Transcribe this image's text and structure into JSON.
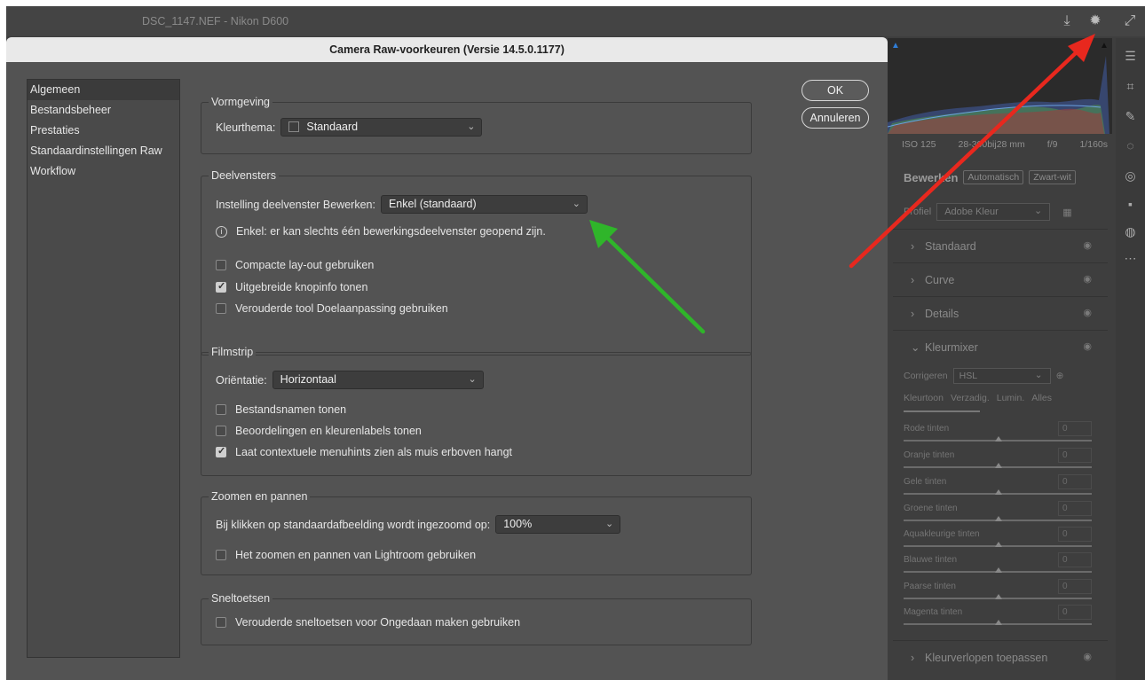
{
  "app": {
    "title": "DSC_1147.NEF  -  Nikon D600",
    "save_icon": "save-icon",
    "settings_icon": "gear-icon",
    "expand_icon": "expand-icon"
  },
  "exif": {
    "iso": "ISO 125",
    "lens": "28-300bij28 mm",
    "aperture": "f/9",
    "shutter": "1/160s"
  },
  "edit_panel": {
    "title": "Bewerken",
    "auto_label": "Automatisch",
    "bw_label": "Zwart-wit",
    "profile_label": "Profiel",
    "profile_value": "Adobe Kleur",
    "sections": [
      {
        "label": "Standaard"
      },
      {
        "label": "Curve"
      },
      {
        "label": "Details"
      },
      {
        "label": "Kleurmixer"
      },
      {
        "label": "Kleurverlopen toepassen"
      }
    ],
    "mixer": {
      "correct_label": "Corrigeren",
      "correct_value": "HSL",
      "tabs": [
        "Kleurtoon",
        "Verzadig.",
        "Lumin.",
        "Alles"
      ],
      "sliders": [
        {
          "label": "Rode tinten",
          "value": "0"
        },
        {
          "label": "Oranje tinten",
          "value": "0"
        },
        {
          "label": "Gele tinten",
          "value": "0"
        },
        {
          "label": "Groene tinten",
          "value": "0"
        },
        {
          "label": "Aquakleurige tinten",
          "value": "0"
        },
        {
          "label": "Blauwe tinten",
          "value": "0"
        },
        {
          "label": "Paarse tinten",
          "value": "0"
        },
        {
          "label": "Magenta tinten",
          "value": "0"
        }
      ]
    }
  },
  "dialog": {
    "title": "Camera Raw-voorkeuren  (Versie 14.5.0.1177)",
    "ok_label": "OK",
    "cancel_label": "Annuleren",
    "nav": [
      "Algemeen",
      "Bestandsbeheer",
      "Prestaties",
      "Standaardinstellingen Raw",
      "Workflow"
    ],
    "nav_active": "Algemeen",
    "vormgeving": {
      "title": "Vormgeving",
      "theme_label": "Kleurthema:",
      "theme_value": "Standaard"
    },
    "deelvensters": {
      "title": "Deelvensters",
      "setting_label": "Instelling deelvenster Bewerken:",
      "setting_value": "Enkel (standaard)",
      "info": "Enkel: er kan slechts één bewerkingsdeelvenster geopend zijn.",
      "options": [
        {
          "label": "Compacte lay-out gebruiken",
          "checked": false
        },
        {
          "label": "Uitgebreide knopinfo tonen",
          "checked": true
        },
        {
          "label": "Verouderde tool Doelaanpassing gebruiken",
          "checked": false
        }
      ]
    },
    "filmstrip": {
      "title": "Filmstrip",
      "orientation_label": "Oriëntatie:",
      "orientation_value": "Horizontaal",
      "options": [
        {
          "label": "Bestandsnamen tonen",
          "checked": false
        },
        {
          "label": "Beoordelingen en kleurenlabels tonen",
          "checked": false
        },
        {
          "label": "Laat contextuele menuhints zien als muis erboven hangt",
          "checked": true
        }
      ]
    },
    "zoom": {
      "title": "Zoomen en pannen",
      "click_label": "Bij klikken op standaardafbeelding wordt ingezoomd op:",
      "click_value": "100%",
      "options": [
        {
          "label": "Het zoomen en pannen van Lightroom gebruiken",
          "checked": false
        }
      ]
    },
    "shortcuts": {
      "title": "Sneltoetsen",
      "options": [
        {
          "label": "Verouderde sneltoetsen voor Ongedaan maken gebruiken",
          "checked": false
        }
      ]
    }
  },
  "annotations": {
    "red_arrow_color": "#e8281e",
    "green_arrow_color": "#2fb52a"
  }
}
